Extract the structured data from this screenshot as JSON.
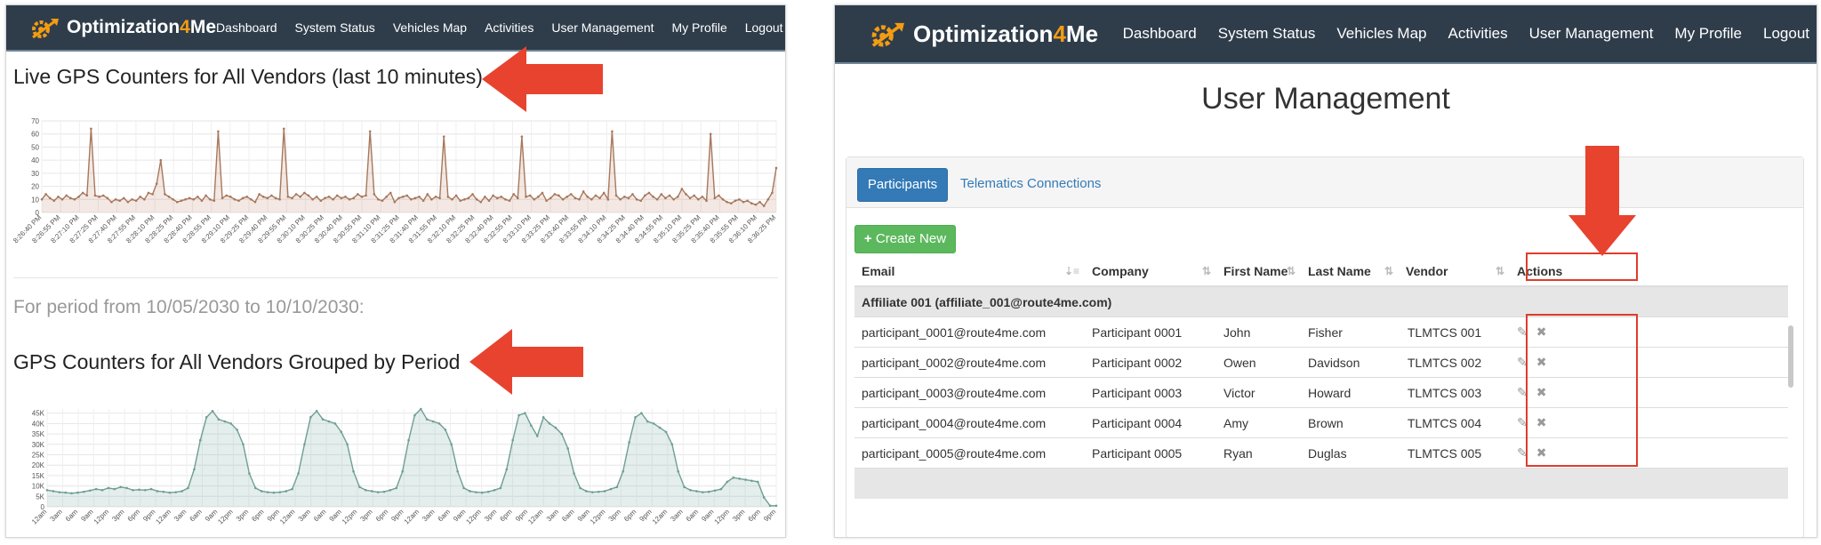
{
  "app": {
    "logo_name": "Optimization",
    "logo_num": "4",
    "logo_suffix": "Me",
    "logo_icon": "gear-arrow-logo-icon",
    "accent": "#f39c12",
    "nav_bg": "#2f3d4b"
  },
  "nav": [
    "Dashboard",
    "System Status",
    "Vehicles Map",
    "Activities",
    "User Management",
    "My Profile",
    "Logout"
  ],
  "left": {
    "live_title": "Live GPS Counters for All Vendors (last 10 minutes)",
    "period_label": "For period from 10/05/2030 to 10/10/2030:",
    "grouped_title": "GPS Counters for All Vendors Grouped by Period"
  },
  "annotation_color": "#e8432f",
  "chart_data": [
    {
      "type": "area",
      "yticks": [
        0,
        10,
        20,
        30,
        40,
        50,
        60,
        70
      ],
      "ylim": [
        0,
        70
      ],
      "x": [
        "8:26:40 PM",
        "8:26:55 PM",
        "8:27:10 PM",
        "8:27:25 PM",
        "8:27:40 PM",
        "8:27:55 PM",
        "8:28:10 PM",
        "8:28:25 PM",
        "8:28:40 PM",
        "8:28:55 PM",
        "8:29:10 PM",
        "8:29:25 PM",
        "8:29:40 PM",
        "8:29:55 PM",
        "8:30:10 PM",
        "8:30:25 PM",
        "8:30:40 PM",
        "8:30:55 PM",
        "8:31:10 PM",
        "8:31:25 PM",
        "8:31:40 PM",
        "8:31:55 PM",
        "8:32:10 PM",
        "8:32:25 PM",
        "8:32:40 PM",
        "8:32:55 PM",
        "8:33:10 PM",
        "8:33:25 PM",
        "8:33:40 PM",
        "8:33:55 PM",
        "8:34:10 PM",
        "8:34:25 PM",
        "8:34:40 PM",
        "8:34:55 PM",
        "8:35:10 PM",
        "8:35:25 PM",
        "8:35:40 PM",
        "8:35:55 PM",
        "8:36:10 PM",
        "8:36:25 PM"
      ],
      "values": [
        10,
        14,
        11,
        9,
        12,
        10,
        13,
        11,
        10,
        12,
        15,
        13,
        64,
        13,
        12,
        13,
        11,
        8,
        10,
        9,
        11,
        8,
        10,
        9,
        12,
        10,
        15,
        14,
        22,
        40,
        14,
        12,
        10,
        8,
        9,
        10,
        11,
        10,
        12,
        9,
        13,
        10,
        9,
        62,
        11,
        13,
        12,
        10,
        9,
        11,
        12,
        10,
        8,
        14,
        12,
        11,
        13,
        11,
        10,
        64,
        12,
        11,
        14,
        12,
        15,
        13,
        10,
        12,
        9,
        11,
        12,
        10,
        13,
        11,
        12,
        10,
        11,
        14,
        12,
        13,
        62,
        14,
        10,
        9,
        12,
        15,
        8,
        11,
        12,
        13,
        10,
        11,
        12,
        9,
        14,
        10,
        12,
        11,
        58,
        12,
        10,
        13,
        9,
        10,
        11,
        14,
        10,
        8,
        12,
        9,
        13,
        11,
        12,
        10,
        9,
        14,
        11,
        58,
        12,
        13,
        10,
        12,
        15,
        9,
        11,
        14,
        13,
        10,
        12,
        14,
        11,
        10,
        16,
        12,
        10,
        13,
        11,
        15,
        10,
        62,
        13,
        10,
        12,
        11,
        14,
        10,
        9,
        13,
        15,
        12,
        10,
        14,
        11,
        13,
        10,
        12,
        18,
        14,
        11,
        13,
        10,
        12,
        9,
        60,
        11,
        13,
        10,
        8,
        7,
        9,
        10,
        8,
        9,
        7,
        6,
        8,
        5,
        10,
        15,
        34
      ]
    },
    {
      "type": "area",
      "yticks": [
        "0",
        "5K",
        "10K",
        "15K",
        "20K",
        "25K",
        "30K",
        "35K",
        "40K",
        "45K"
      ],
      "ylim": [
        0,
        47000
      ],
      "x": [
        "12am",
        "3am",
        "6am",
        "9am",
        "12pm",
        "3pm",
        "6pm",
        "9pm",
        "12am",
        "3am",
        "6am",
        "9am",
        "12pm",
        "3pm",
        "6pm",
        "9pm",
        "12am",
        "3am",
        "6am",
        "9am",
        "12pm",
        "3pm",
        "6pm",
        "9pm",
        "12am",
        "3am",
        "6am",
        "9am",
        "12pm",
        "3pm",
        "6pm",
        "9pm",
        "12am",
        "3am",
        "6am",
        "9am",
        "12pm",
        "3pm",
        "6pm",
        "9pm",
        "12am",
        "3am",
        "6am",
        "9am",
        "12pm",
        "3pm",
        "6pm",
        "9pm"
      ],
      "values": [
        8000,
        7500,
        7000,
        6800,
        6500,
        6800,
        7200,
        7800,
        8500,
        8000,
        9000,
        8500,
        9500,
        9000,
        8000,
        8200,
        8000,
        8500,
        7500,
        7200,
        6800,
        7000,
        7500,
        9000,
        18000,
        32000,
        43000,
        46000,
        42000,
        41000,
        40000,
        37000,
        30000,
        16000,
        9000,
        7500,
        7000,
        6800,
        7000,
        7500,
        8500,
        16000,
        30000,
        43000,
        46000,
        42000,
        41000,
        40000,
        36000,
        30000,
        17000,
        9500,
        8000,
        7500,
        7000,
        7200,
        8000,
        9000,
        17000,
        32000,
        44000,
        47000,
        42000,
        41000,
        40000,
        37000,
        30000,
        17000,
        9000,
        7500,
        7000,
        6800,
        7200,
        8000,
        9000,
        18000,
        32000,
        44000,
        45000,
        39000,
        34000,
        43000,
        40000,
        38000,
        35000,
        28000,
        16000,
        9000,
        7500,
        7000,
        7200,
        7500,
        8500,
        9500,
        17000,
        31000,
        43000,
        45000,
        41000,
        40000,
        38000,
        36000,
        30000,
        17000,
        9500,
        8000,
        7500,
        7000,
        7200,
        7800,
        8500,
        12000,
        14000,
        13500,
        13000,
        12500,
        12000,
        4500,
        500,
        500
      ]
    }
  ],
  "right": {
    "page_title": "User Management",
    "tabs": [
      "Participants",
      "Telematics Connections"
    ],
    "create_label": "Create New",
    "columns": [
      "Email",
      "Company",
      "First Name",
      "Last Name",
      "Vendor",
      "Actions"
    ],
    "group_label": "Affiliate 001 (affiliate_001@route4me.com)",
    "rows": [
      {
        "email": "participant_0001@route4me.com",
        "company": "Participant 0001",
        "first": "John",
        "last": "Fisher",
        "vendor": "TLMTCS 001"
      },
      {
        "email": "participant_0002@route4me.com",
        "company": "Participant 0002",
        "first": "Owen",
        "last": "Davidson",
        "vendor": "TLMTCS 002"
      },
      {
        "email": "participant_0003@route4me.com",
        "company": "Participant 0003",
        "first": "Victor",
        "last": "Howard",
        "vendor": "TLMTCS 003"
      },
      {
        "email": "participant_0004@route4me.com",
        "company": "Participant 0004",
        "first": "Amy",
        "last": "Brown",
        "vendor": "TLMTCS 004"
      },
      {
        "email": "participant_0005@route4me.com",
        "company": "Participant 0005",
        "first": "Ryan",
        "last": "Duglas",
        "vendor": "TLMTCS 005"
      }
    ],
    "action_icons": [
      "pencil-icon",
      "delete-x-icon"
    ],
    "primary_color": "#337ab7",
    "success_color": "#5cb85c"
  }
}
